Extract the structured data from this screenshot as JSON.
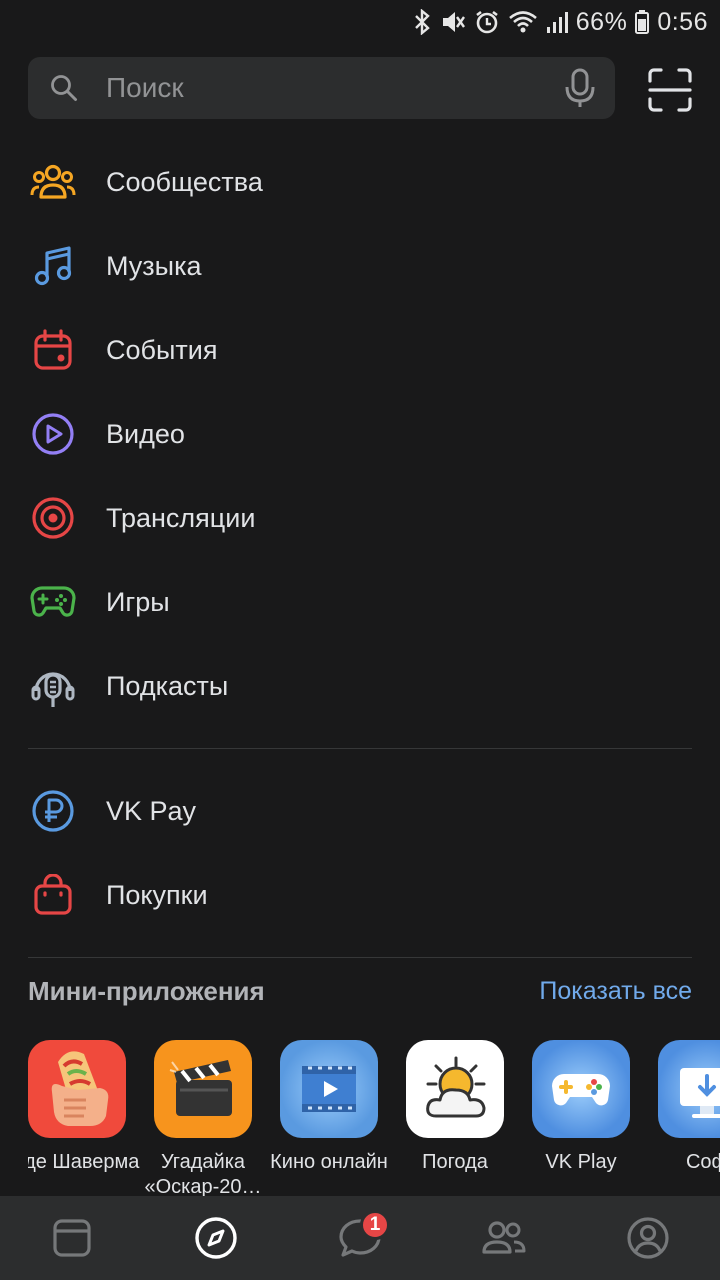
{
  "status_bar": {
    "battery": "66%",
    "time": "0:56"
  },
  "search": {
    "placeholder": "Поиск"
  },
  "menu": [
    {
      "label": "Сообщества",
      "icon": "communities-icon",
      "color": "#f5a623"
    },
    {
      "label": "Музыка",
      "icon": "music-icon",
      "color": "#5a9ae0"
    },
    {
      "label": "События",
      "icon": "events-icon",
      "color": "#e64646"
    },
    {
      "label": "Видео",
      "icon": "video-icon",
      "color": "#937ff5"
    },
    {
      "label": "Трансляции",
      "icon": "live-icon",
      "color": "#e64646"
    },
    {
      "label": "Игры",
      "icon": "games-icon",
      "color": "#4bb34b"
    },
    {
      "label": "Подкасты",
      "icon": "podcasts-icon",
      "color": "#aeb7c2"
    }
  ],
  "menu2": [
    {
      "label": "VK Pay",
      "icon": "vk-pay-icon",
      "color": "#5a9ae0"
    },
    {
      "label": "Покупки",
      "icon": "shopping-icon",
      "color": "#e64646"
    }
  ],
  "mini_apps": {
    "title": "Мини-приложения",
    "show_all": "Показать все",
    "items": [
      {
        "name": "Где Шаверма",
        "icon": "shawarma-icon"
      },
      {
        "name": "Угадайка «Оскар-20…",
        "icon": "clapperboard-icon"
      },
      {
        "name": "Кино онлайн",
        "icon": "film-icon"
      },
      {
        "name": "Погода",
        "icon": "weather-icon"
      },
      {
        "name": "VK Play",
        "icon": "gamepad-icon"
      },
      {
        "name": "Соф",
        "icon": "download-icon"
      }
    ]
  },
  "tabbar": {
    "messages_badge": "1"
  }
}
